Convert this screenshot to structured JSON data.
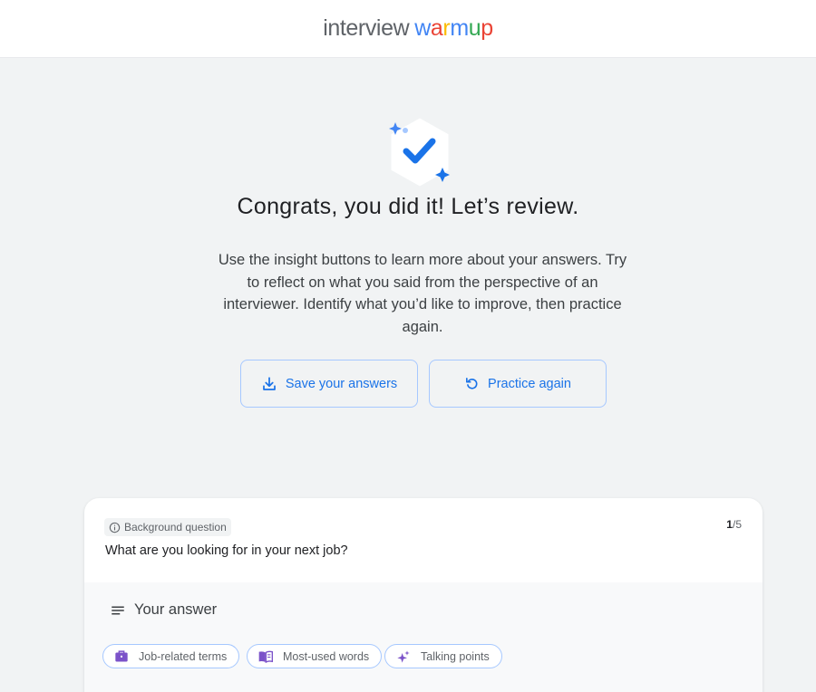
{
  "header": {
    "logo_word1": "interview",
    "logo_word2": "warmup",
    "logo_colors": [
      "#4285f4",
      "#ea4335",
      "#fbbc04",
      "#4285f4",
      "#34a853",
      "#ea4335"
    ]
  },
  "hero": {
    "icon": "check-badge-icon",
    "title": "Congrats, you did it! Let’s review.",
    "description": "Use the insight buttons to learn more about your answers. Try to reflect on what you said from the perspective of an interviewer. Identify what you’d like to improve, then practice again."
  },
  "actions": {
    "save_label": "Save your answers",
    "save_icon": "download-icon",
    "practice_label": "Practice again",
    "practice_icon": "replay-icon"
  },
  "question_card": {
    "tag_label": "Background question",
    "tag_icon": "info-icon",
    "counter_current": "1",
    "counter_total": "/5",
    "question": "What are you looking for in your next job?",
    "answer_heading": "Your answer",
    "answer_icon": "notes-icon",
    "chips": [
      {
        "label": "Job-related terms",
        "icon": "briefcase-icon"
      },
      {
        "label": "Most-used words",
        "icon": "book-icon"
      },
      {
        "label": "Talking points",
        "icon": "sparkle-icon"
      }
    ]
  },
  "colors": {
    "accent": "#1a73e8",
    "page_bg": "#f1f3f4",
    "border": "#a6c8ff",
    "chip_icon": "#7b52c9"
  }
}
